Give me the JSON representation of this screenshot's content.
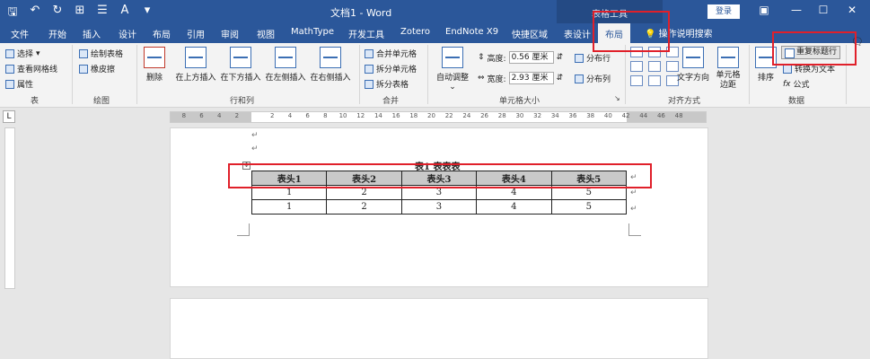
{
  "titlebar": {
    "doc_title": "文档1 - Word",
    "context_group": "表格工具",
    "login": "登录"
  },
  "menu": {
    "tabs": [
      "文件",
      "开始",
      "插入",
      "设计",
      "布局",
      "引用",
      "审阅",
      "视图",
      "MathType",
      "开发工具",
      "Zotero",
      "EndNote X9",
      "快捷区域",
      "表设计"
    ],
    "active_tab": "布局",
    "tell_me": "操作说明搜索"
  },
  "ribbon": {
    "table_group": {
      "select": "选择",
      "gridlines": "查看网格线",
      "properties": "属性",
      "label": "表"
    },
    "draw_group": {
      "draw": "绘制表格",
      "eraser": "橡皮擦",
      "label": "绘图"
    },
    "rows_cols": {
      "delete": "删除",
      "insert_above": "在上方插入",
      "insert_below": "在下方插入",
      "insert_left": "在左侧插入",
      "insert_right": "在右侧插入",
      "label": "行和列"
    },
    "merge": {
      "merge_cells": "合并单元格",
      "split_cells": "拆分单元格",
      "split_table": "拆分表格",
      "label": "合并"
    },
    "cell_size": {
      "autofit": "自动调整",
      "height_label": "高度:",
      "height_value": "0.56 厘米",
      "width_label": "宽度:",
      "width_value": "2.93 厘米",
      "dist_rows": "分布行",
      "dist_cols": "分布列",
      "label": "单元格大小"
    },
    "alignment": {
      "text_direction": "文字方向",
      "cell_margins": "单元格边距",
      "label": "对齐方式"
    },
    "data": {
      "sort": "排序",
      "repeat_header": "重复标题行",
      "convert": "转换为文本",
      "formula": "公式",
      "label": "数据"
    }
  },
  "ruler_ticks": [
    "8",
    "6",
    "4",
    "2",
    "",
    "2",
    "4",
    "6",
    "8",
    "10",
    "12",
    "14",
    "16",
    "18",
    "20",
    "22",
    "24",
    "26",
    "28",
    "30",
    "32",
    "34",
    "36",
    "38",
    "40",
    "42",
    "44",
    "46",
    "48"
  ],
  "document": {
    "caption": "表1 表表表",
    "table": {
      "headers": [
        "表头1",
        "表头2",
        "表头3",
        "表头4",
        "表头5"
      ],
      "rows": [
        [
          "1",
          "2",
          "3",
          "4",
          "5"
        ],
        [
          "1",
          "2",
          "3",
          "4",
          "5"
        ]
      ]
    },
    "para_mark": "↵"
  }
}
